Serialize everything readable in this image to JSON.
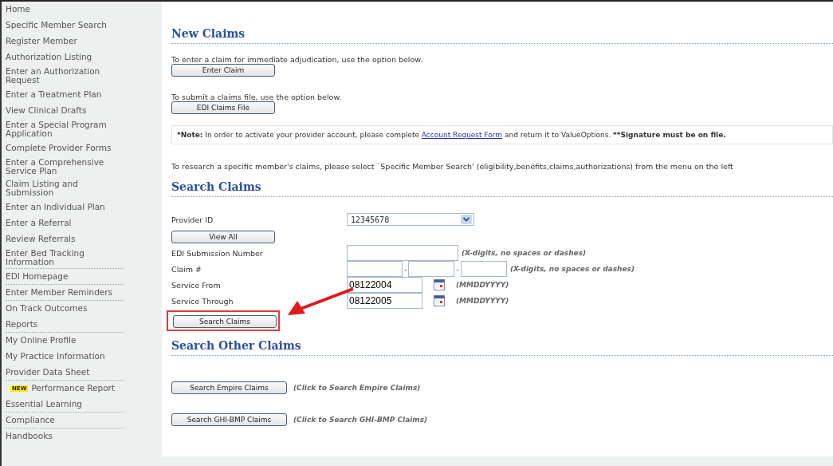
{
  "sidebar": {
    "items": [
      {
        "label": "Home",
        "divider": false
      },
      {
        "label": "Specific Member Search",
        "divider": false
      },
      {
        "label": "Register Member",
        "divider": false
      },
      {
        "label": "Authorization Listing",
        "divider": false
      },
      {
        "label": "Enter an Authorization Request",
        "divider": false
      },
      {
        "label": "Enter a Treatment Plan",
        "divider": false
      },
      {
        "label": "View Clinical Drafts",
        "divider": false
      },
      {
        "label": "Enter a Special Program Application",
        "divider": false
      },
      {
        "label": "Complete Provider Forms",
        "divider": false
      },
      {
        "label": "Enter a Comprehensive Service Plan",
        "divider": false
      },
      {
        "label": "Claim Listing and Submission",
        "divider": false
      },
      {
        "label": "Enter an Individual Plan",
        "divider": false
      },
      {
        "label": "Enter a Referral",
        "divider": false
      },
      {
        "label": "Review Referrals",
        "divider": false
      },
      {
        "label": "Enter Bed Tracking Information",
        "divider": true
      },
      {
        "label": "EDI Homepage",
        "divider": true
      },
      {
        "label": "Enter Member Reminders",
        "divider": true
      },
      {
        "label": "On Track Outcomes",
        "divider": false
      },
      {
        "label": "Reports",
        "divider": true
      },
      {
        "label": "My Online Profile",
        "divider": false
      },
      {
        "label": "My Practice Information",
        "divider": false
      },
      {
        "label": "Provider Data Sheet",
        "divider": true
      },
      {
        "label": "Performance Report",
        "badge": "NEW",
        "divider": false
      },
      {
        "label": "Essential Learning",
        "divider": true
      },
      {
        "label": "Compliance",
        "divider": true
      },
      {
        "label": "Handbooks",
        "divider": false
      }
    ]
  },
  "new_claims": {
    "heading": "New Claims",
    "options": [
      {
        "text": "To enter a claim for immediate adjudication, use the option below.",
        "button": "Enter Claim"
      },
      {
        "text": "To submit a claims file, use the option below.",
        "button": "EDI Claims File"
      }
    ],
    "note": {
      "label": "*Note:",
      "before": "In order to activate your provider account, please complete",
      "link": "Account Request Form",
      "after": "and return it to ValueOptions.",
      "emphasis": "**Signature must be on file."
    },
    "research_text": "To research a specific member's claims, please select `Specific Member Search' (eligibility,benefits,claims,authorizations) from the menu on the left"
  },
  "search_claims": {
    "heading": "Search Claims",
    "provider_id": {
      "label": "Provider ID",
      "value": "12345678"
    },
    "view_all_button": "View All",
    "edi_submission": {
      "label": "EDI Submission Number",
      "hint": "(X-digits, no spaces or dashes)"
    },
    "claim_number": {
      "label": "Claim #",
      "separators": [
        "-",
        "-"
      ],
      "hint": "(X-digits, no spaces or dashes)"
    },
    "service_from": {
      "label": "Service From",
      "value": "08122004",
      "hint": "(MMDDYYYY)"
    },
    "service_through": {
      "label": "Service Through",
      "value": "08122005",
      "hint": "(MMDDYYYY)"
    },
    "search_button": "Search Claims"
  },
  "search_other_claims": {
    "heading": "Search Other Claims",
    "options": [
      {
        "button": "Search Empire Claims",
        "hint": "(Click to Search Empire Claims)"
      },
      {
        "button": "Search GHI-BMP Claims",
        "hint": "(Click to Search GHI-BMP Claims)"
      }
    ]
  }
}
